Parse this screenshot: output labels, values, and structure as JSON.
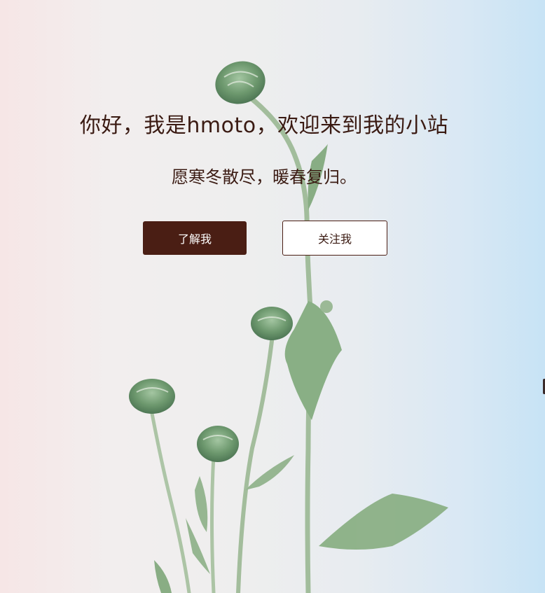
{
  "hero": {
    "title": "你好，我是hmoto，欢迎来到我的小站",
    "subtitle": "愿寒冬散尽，暖春复归。"
  },
  "buttons": {
    "about_label": "了解我",
    "follow_label": "关注我"
  },
  "colors": {
    "text": "#3a1a12",
    "primary_button": "#4a1e14",
    "plant_green": "#6f9a6a",
    "plant_dark": "#3f6e45"
  },
  "icons": {
    "background": "plant-illustration"
  }
}
